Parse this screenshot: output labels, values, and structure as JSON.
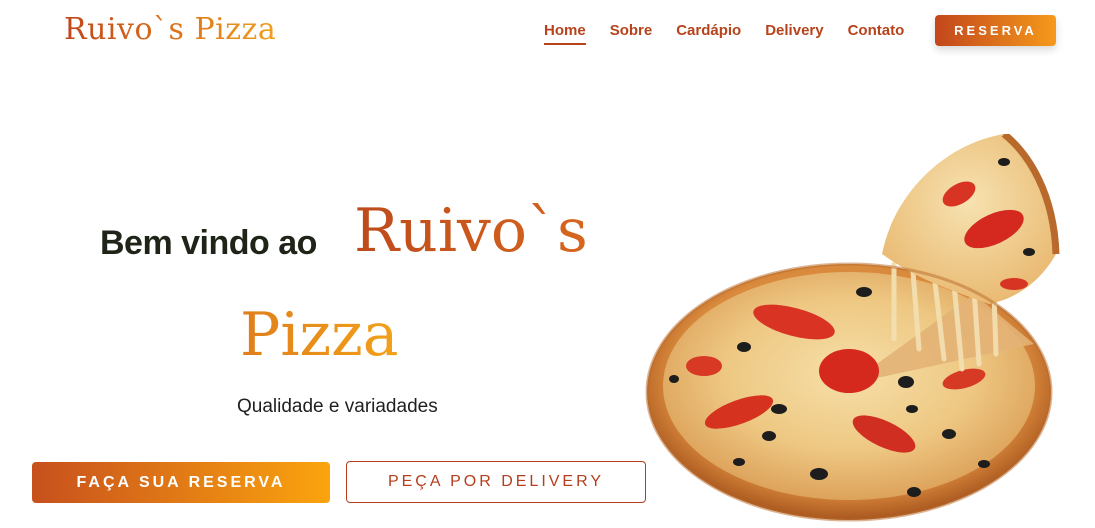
{
  "header": {
    "logo": "Ruivo`s Pizza",
    "nav": [
      {
        "label": "Home",
        "active": true
      },
      {
        "label": "Sobre",
        "active": false
      },
      {
        "label": "Cardápio",
        "active": false
      },
      {
        "label": "Delivery",
        "active": false
      },
      {
        "label": "Contato",
        "active": false
      }
    ],
    "reserve_button": "RESERVA"
  },
  "hero": {
    "welcome": "Bem vindo ao",
    "brand_line1": "Ruivo`s",
    "brand_line2": "Pizza",
    "tagline": "Qualidade e variadades",
    "primary_button": "FAÇA SUA RESERVA",
    "secondary_button": "PEÇA POR DELIVERY",
    "image": "pizza-photo"
  },
  "colors": {
    "accent_dark": "#b7431c",
    "accent_light": "#f59a1b",
    "text_dark": "#1f2418"
  }
}
